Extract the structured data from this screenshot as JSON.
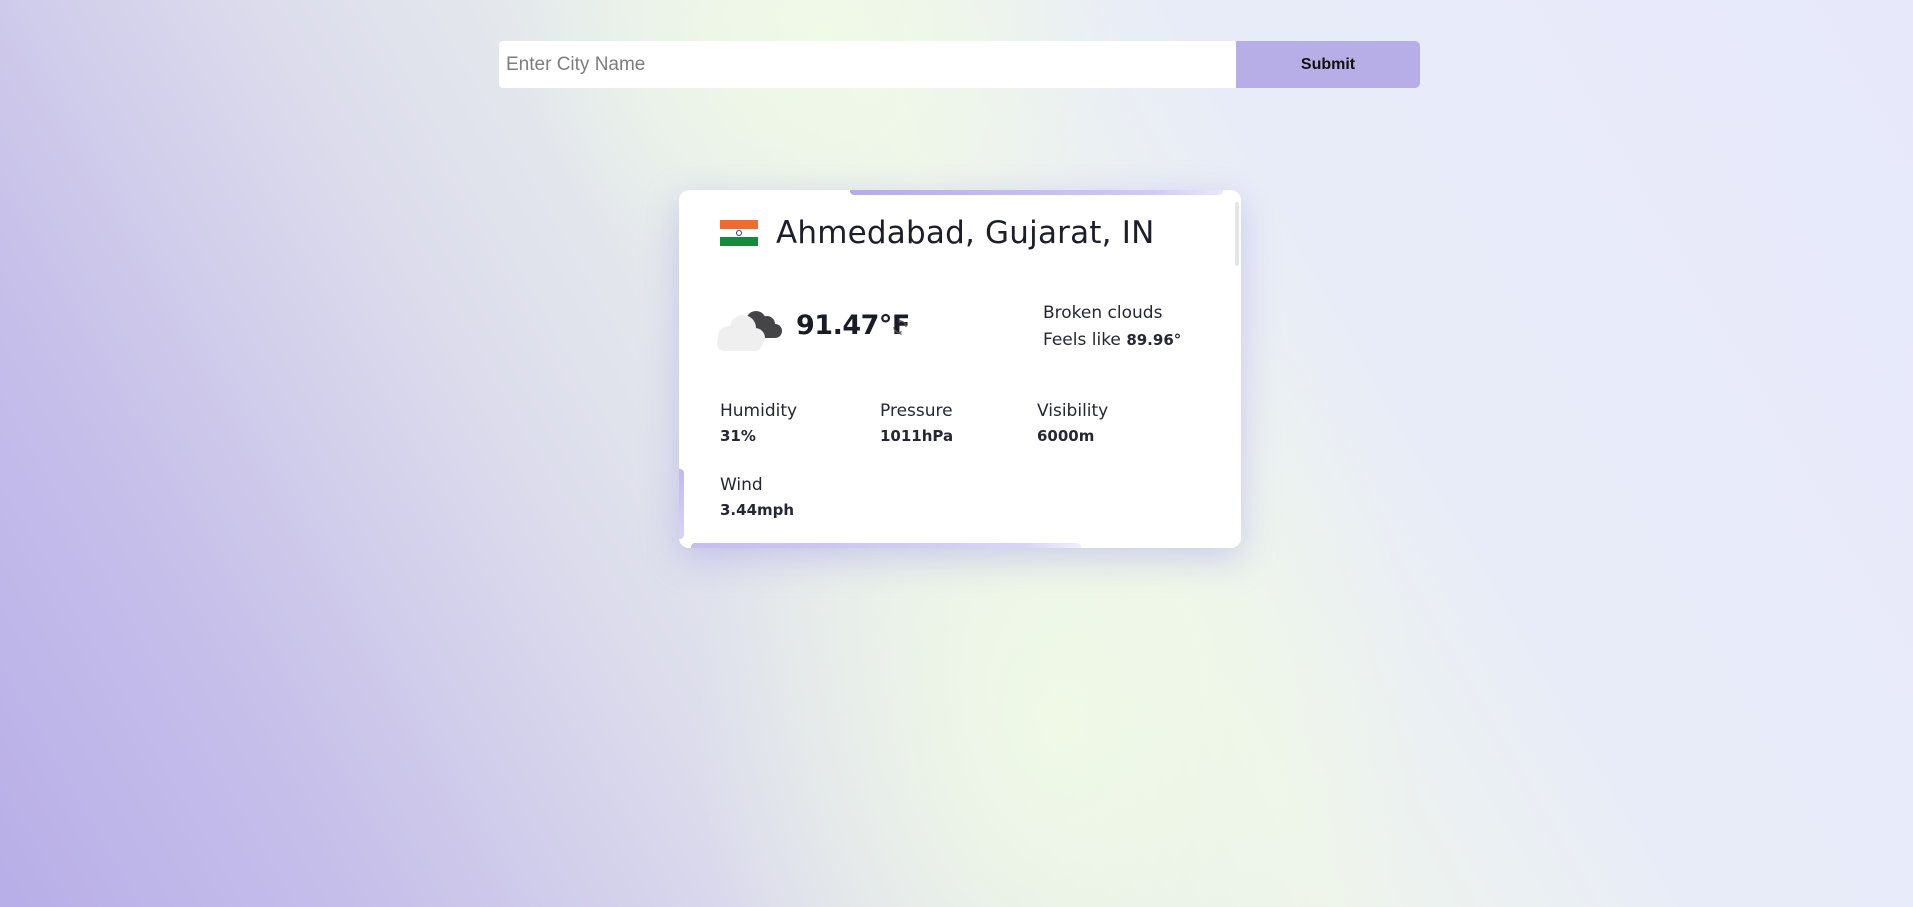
{
  "search": {
    "placeholder": "Enter City Name",
    "value": "",
    "submit_label": "Submit"
  },
  "weather": {
    "country_flag": "india-flag-icon",
    "location": "Ahmedabad, Gujarat, IN",
    "icon": "broken-clouds-icon",
    "temperature": "91.47°F",
    "unit_toggle_icon": "refresh-icon",
    "description": "Broken clouds",
    "feels_like_label": "Feels like",
    "feels_like_value": "89.96°",
    "stats": {
      "humidity": {
        "label": "Humidity",
        "value": "31%"
      },
      "pressure": {
        "label": "Pressure",
        "value": "1011hPa"
      },
      "visibility": {
        "label": "Visibility",
        "value": "6000m"
      },
      "wind": {
        "label": "Wind",
        "value": "3.44mph"
      }
    }
  },
  "colors": {
    "accent": "#b7aee8",
    "card_background": "#ffffff",
    "text_primary": "#1d1d2b"
  }
}
